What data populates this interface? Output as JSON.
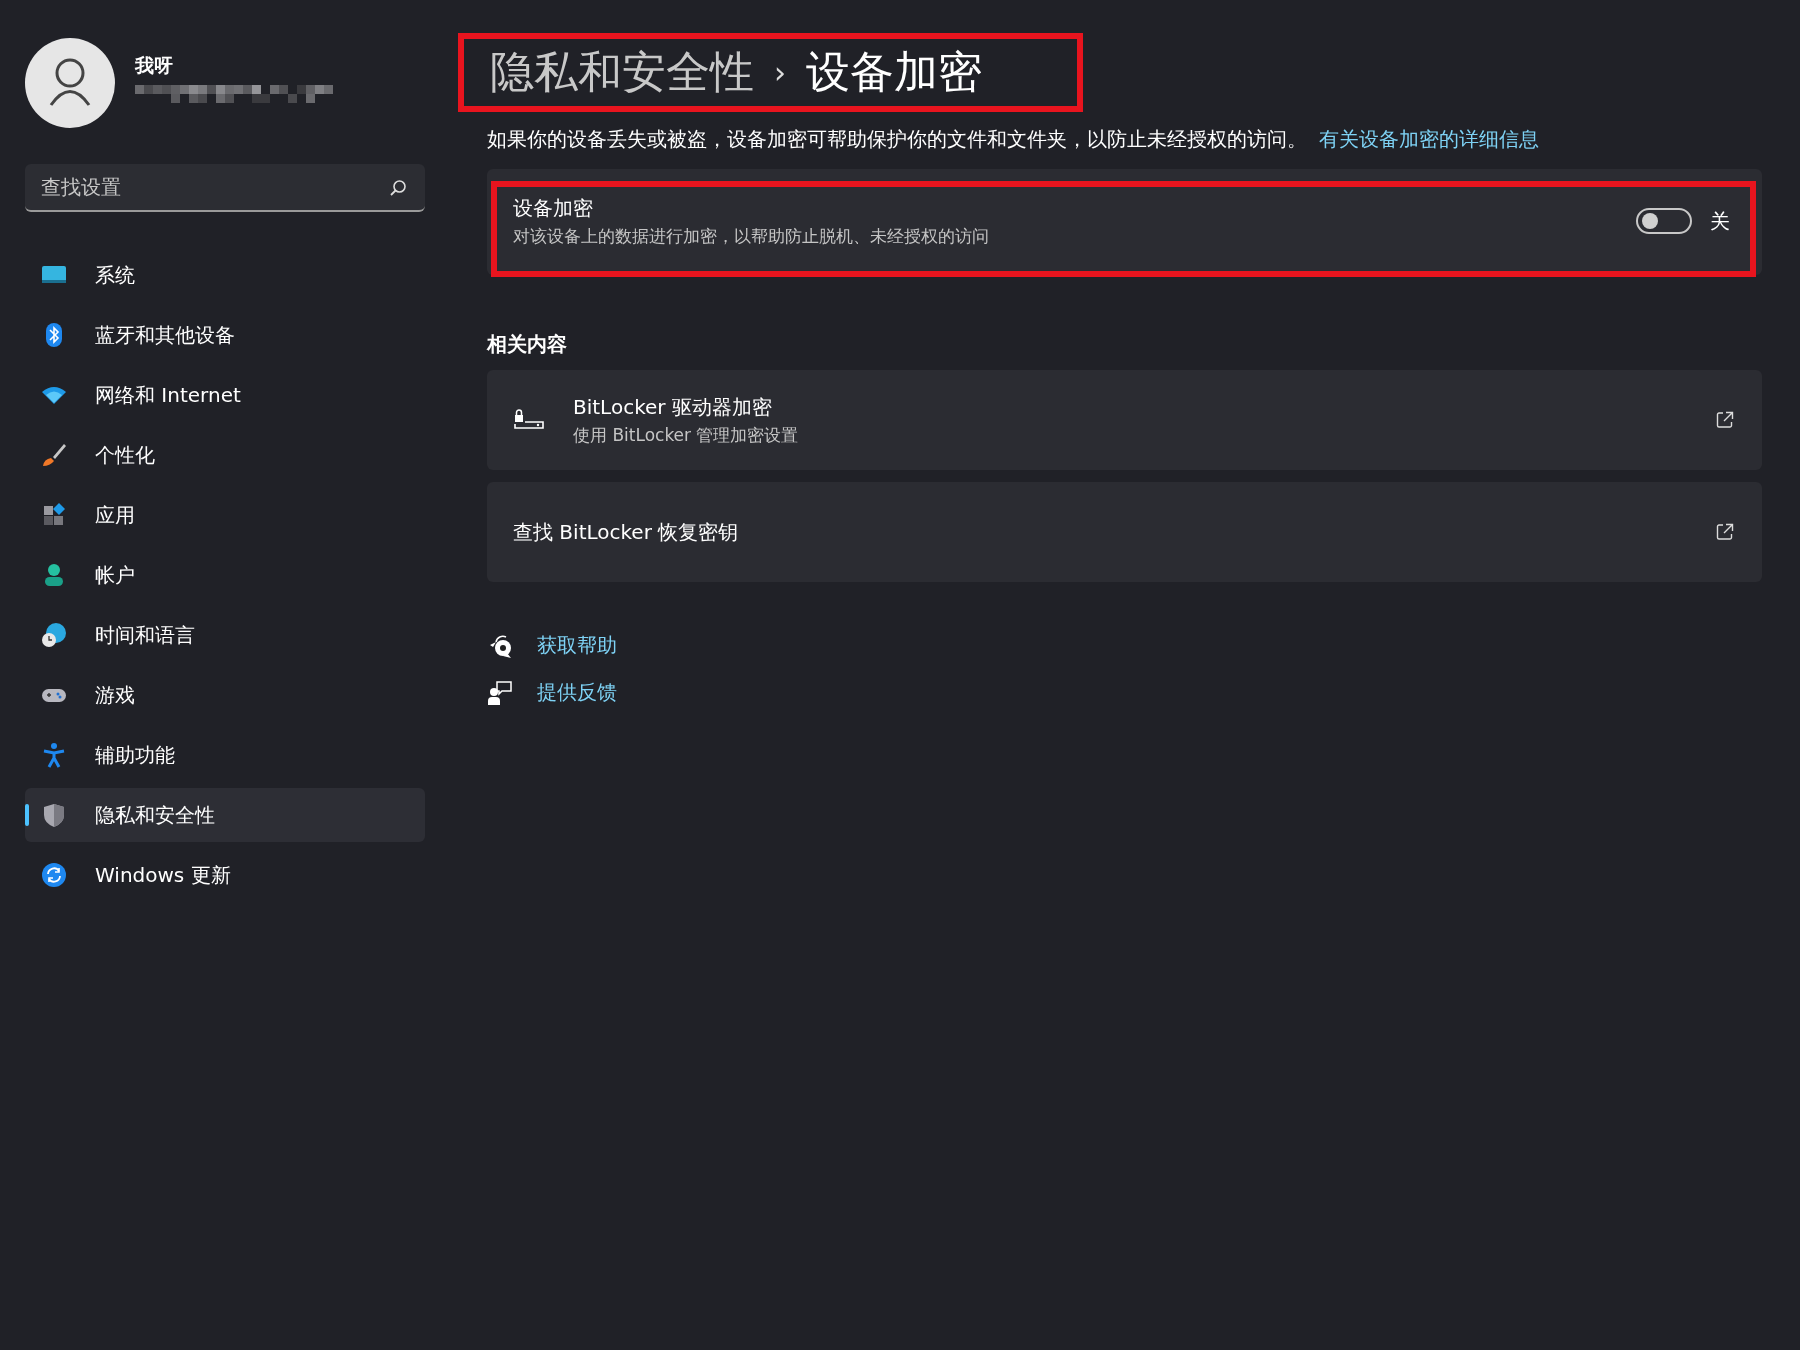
{
  "user": {
    "name": "我呀"
  },
  "search": {
    "placeholder": "查找设置"
  },
  "sidebar": {
    "items": [
      {
        "label": "系统",
        "kind": "system",
        "selected": false
      },
      {
        "label": "蓝牙和其他设备",
        "kind": "bluetooth",
        "selected": false
      },
      {
        "label": "网络和 Internet",
        "kind": "wifi",
        "selected": false
      },
      {
        "label": "个性化",
        "kind": "brush",
        "selected": false
      },
      {
        "label": "应用",
        "kind": "apps",
        "selected": false
      },
      {
        "label": "帐户",
        "kind": "person",
        "selected": false
      },
      {
        "label": "时间和语言",
        "kind": "globe",
        "selected": false
      },
      {
        "label": "游戏",
        "kind": "gamepad",
        "selected": false
      },
      {
        "label": "辅助功能",
        "kind": "accessibility",
        "selected": false
      },
      {
        "label": "隐私和安全性",
        "kind": "shield",
        "selected": true
      },
      {
        "label": "Windows 更新",
        "kind": "update",
        "selected": false
      }
    ]
  },
  "header": {
    "breadcrumb": "隐私和安全性",
    "separator": "›",
    "title": "设备加密",
    "highlighted": true
  },
  "description": {
    "text": "如果你的设备丢失或被盗，设备加密可帮助保护你的文件和文件夹，以防止未经授权的访问。",
    "link": "有关设备加密的详细信息"
  },
  "encryption_setting": {
    "title": "设备加密",
    "subtitle": "对该设备上的数据进行加密，以帮助防止脱机、未经授权的访问",
    "on": false,
    "state_label": "关",
    "highlighted": true
  },
  "related": {
    "heading": "相关内容",
    "items": [
      {
        "kind": "icon",
        "title": "BitLocker 驱动器加密",
        "subtitle": "使用 BitLocker 管理加密设置"
      },
      {
        "kind": "plain",
        "title": "查找 BitLocker 恢复密钥"
      }
    ]
  },
  "help_links": [
    {
      "label": "获取帮助",
      "kind": "help"
    },
    {
      "label": "提供反馈",
      "kind": "feedback"
    }
  ]
}
